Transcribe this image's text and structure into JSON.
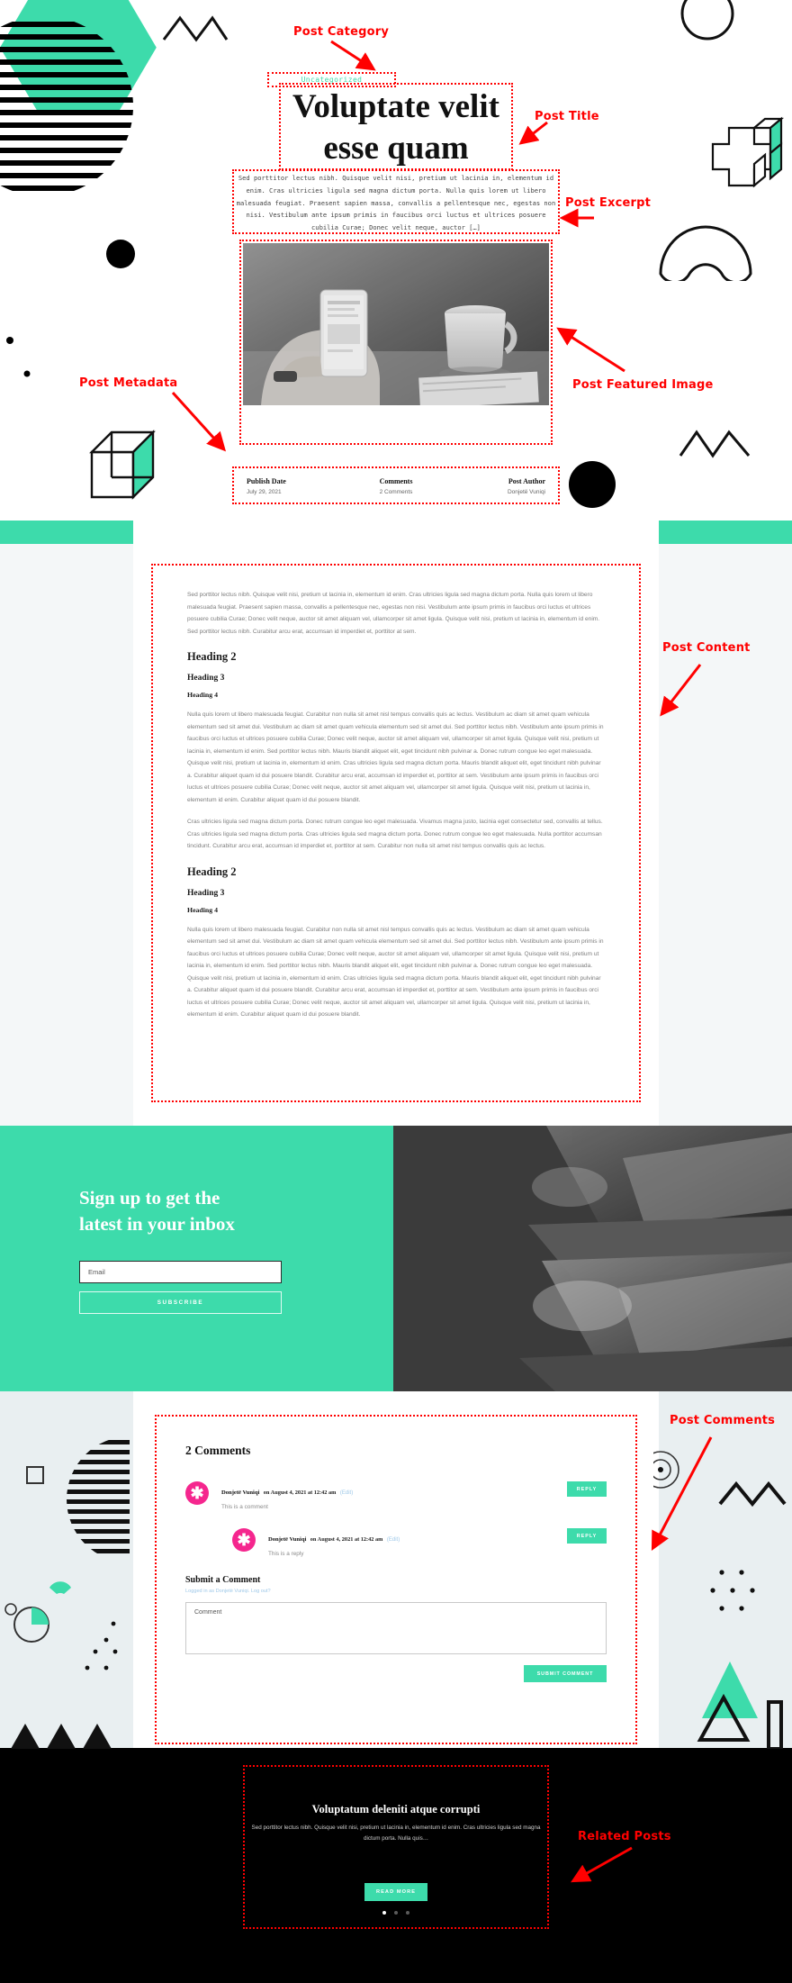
{
  "annotations": [
    {
      "id": "post-category",
      "label": "Post Category"
    },
    {
      "id": "post-title",
      "label": "Post Title"
    },
    {
      "id": "post-excerpt",
      "label": "Post Excerpt"
    },
    {
      "id": "post-metadata",
      "label": "Post Metadata"
    },
    {
      "id": "post-featured-image",
      "label": "Post Featured Image"
    },
    {
      "id": "post-content",
      "label": "Post Content"
    },
    {
      "id": "post-comments",
      "label": "Post Comments"
    },
    {
      "id": "related-posts",
      "label": "Related Posts"
    }
  ],
  "hero": {
    "category": "Uncategorized",
    "title_line1": "Voluptate velit",
    "title_line2": "esse quam",
    "excerpt": "Sed porttitor lectus nibh. Quisque velit nisi, pretium ut lacinia in, elementum id enim. Cras ultricies ligula sed magna dictum porta. Nulla quis lorem ut libero malesuada feugiat. Praesent sapien massa, convallis a pellentesque nec, egestas non nisi. Vestibulum ante ipsum primis in faucibus orci luctus et ultrices posuere cubilia Curae; Donec velit neque, auctor […]",
    "meta": {
      "publish_date_label": "Publish Date",
      "publish_date_value": "July 29, 2021",
      "comments_label": "Comments",
      "comments_value": "2 Comments",
      "author_label": "Post Author",
      "author_value": "Donjetë Vuniqi"
    }
  },
  "content": {
    "p1": "Sed porttitor lectus nibh. Quisque velit nisi, pretium ut lacinia in, elementum id enim. Cras ultricies ligula sed magna dictum porta. Nulla quis lorem ut libero malesuada feugiat. Praesent sapien massa, convallis a pellentesque nec, egestas non nisi. Vestibulum ante ipsum primis in faucibus orci luctus et ultrices posuere cubilia Curae; Donec velit neque, auctor sit amet aliquam vel, ullamcorper sit amet ligula. Quisque velit nisi, pretium ut lacinia in, elementum id enim. Sed porttitor lectus nibh. Curabitur arcu erat, accumsan id imperdiet et, porttitor at sem.",
    "h2_a": "Heading 2",
    "h3_a": "Heading 3",
    "h4_a": "Heading 4",
    "p2": "Nulla quis lorem ut libero malesuada feugiat. Curabitur non nulla sit amet nisl tempus convallis quis ac lectus. Vestibulum ac diam sit amet quam vehicula elementum sed sit amet dui. Vestibulum ac diam sit amet quam vehicula elementum sed sit amet dui. Sed porttitor lectus nibh. Vestibulum ante ipsum primis in faucibus orci luctus et ultrices posuere cubilia Curae; Donec velit neque, auctor sit amet aliquam vel, ullamcorper sit amet ligula. Quisque velit nisi, pretium ut lacinia in, elementum id enim. Sed porttitor lectus nibh. Mauris blandit aliquet elit, eget tincidunt nibh pulvinar a. Donec rutrum congue leo eget malesuada. Quisque velit nisi, pretium ut lacinia in, elementum id enim. Cras ultricies ligula sed magna dictum porta. Mauris blandit aliquet elit, eget tincidunt nibh pulvinar a. Curabitur aliquet quam id dui posuere blandit. Curabitur arcu erat, accumsan id imperdiet et, porttitor at sem. Vestibulum ante ipsum primis in faucibus orci luctus et ultrices posuere cubilia Curae; Donec velit neque, auctor sit amet aliquam vel, ullamcorper sit amet ligula. Quisque velit nisi, pretium ut lacinia in, elementum id enim. Curabitur aliquet quam id dui posuere blandit.",
    "p3": "Cras ultricies ligula sed magna dictum porta. Donec rutrum congue leo eget malesuada. Vivamus magna justo, lacinia eget consectetur sed, convallis at tellus. Cras ultricies ligula sed magna dictum porta. Cras ultricies ligula sed magna dictum porta. Donec rutrum congue leo eget malesuada. Nulla porttitor accumsan tincidunt. Curabitur arcu erat, accumsan id imperdiet et, porttitor at sem. Curabitur non nulla sit amet nisl tempus convallis quis ac lectus.",
    "h2_b": "Heading 2",
    "h3_b": "Heading 3",
    "h4_b": "Heading 4",
    "p4": "Nulla quis lorem ut libero malesuada feugiat. Curabitur non nulla sit amet nisl tempus convallis quis ac lectus. Vestibulum ac diam sit amet quam vehicula elementum sed sit amet dui. Vestibulum ac diam sit amet quam vehicula elementum sed sit amet dui. Sed porttitor lectus nibh. Vestibulum ante ipsum primis in faucibus orci luctus et ultrices posuere cubilia Curae; Donec velit neque, auctor sit amet aliquam vel, ullamcorper sit amet ligula. Quisque velit nisi, pretium ut lacinia in, elementum id enim. Sed porttitor lectus nibh. Mauris blandit aliquet elit, eget tincidunt nibh pulvinar a. Donec rutrum congue leo eget malesuada. Quisque velit nisi, pretium ut lacinia in, elementum id enim. Cras ultricies ligula sed magna dictum porta. Mauris blandit aliquet elit, eget tincidunt nibh pulvinar a. Curabitur aliquet quam id dui posuere blandit. Curabitur arcu erat, accumsan id imperdiet et, porttitor at sem. Vestibulum ante ipsum primis in faucibus orci luctus et ultrices posuere cubilia Curae; Donec velit neque, auctor sit amet aliquam vel, ullamcorper sit amet ligula. Quisque velit nisi, pretium ut lacinia in, elementum id enim. Curabitur aliquet quam id dui posuere blandit."
  },
  "newsletter": {
    "title_line1": "Sign up to get the",
    "title_line2": "latest in your inbox",
    "email_placeholder": "Email",
    "subscribe_label": "SUBSCRIBE"
  },
  "comments": {
    "heading": "2 Comments",
    "items": [
      {
        "author": "Donjetë Vuniqi",
        "date": "on August 4, 2021 at 12:42 am",
        "edit": "(Edit)",
        "text": "This is a comment",
        "reply_label": "REPLY",
        "is_reply": false
      },
      {
        "author": "Donjetë Vuniqi",
        "date": "on August 4, 2021 at 12:42 am",
        "edit": "(Edit)",
        "text": "This is a reply",
        "reply_label": "REPLY",
        "is_reply": true
      }
    ],
    "form": {
      "heading": "Submit a Comment",
      "note": "Logged in as Donjetë Vuniqi. Log out?",
      "textarea_placeholder": "Comment",
      "submit_label": "SUBMIT COMMENT"
    }
  },
  "related": {
    "title": "Voluptatum deleniti atque corrupti",
    "excerpt": "Sed porttitor lectus nibh. Quisque velit nisi, pretium ut lacinia in, elementum id enim. Cras ultricies ligula sed magna dictum porta. Nulla quis…",
    "read_more_label": "READ MORE",
    "dots": 3,
    "active_dot": 0
  },
  "colors": {
    "accent_mint": "#3ddbab",
    "annotation_red": "#ff0000",
    "avatar_pink": "#f5268e",
    "link_blue": "#9ec8e8",
    "dark": "#000000"
  }
}
